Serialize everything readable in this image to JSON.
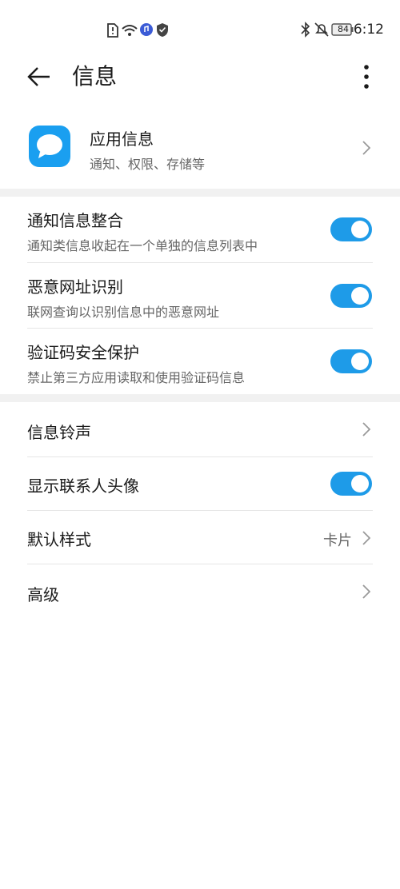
{
  "status": {
    "time": "6:12",
    "battery": "84"
  },
  "header": {
    "title": "信息"
  },
  "app_info": {
    "title": "应用信息",
    "subtitle": "通知、权限、存储等"
  },
  "toggles": [
    {
      "title": "通知信息整合",
      "subtitle": "通知类信息收起在一个单独的信息列表中",
      "on": true
    },
    {
      "title": "恶意网址识别",
      "subtitle": "联网查询以识别信息中的恶意网址",
      "on": true
    },
    {
      "title": "验证码安全保护",
      "subtitle": "禁止第三方应用读取和使用验证码信息",
      "on": true
    }
  ],
  "settings": [
    {
      "label": "信息铃声"
    },
    {
      "label": "显示联系人头像",
      "on": true
    },
    {
      "label": "默认样式",
      "value": "卡片"
    },
    {
      "label": "高级"
    }
  ],
  "colors": {
    "accent": "#1e9be8",
    "app_icon": "#1a9ff0"
  }
}
